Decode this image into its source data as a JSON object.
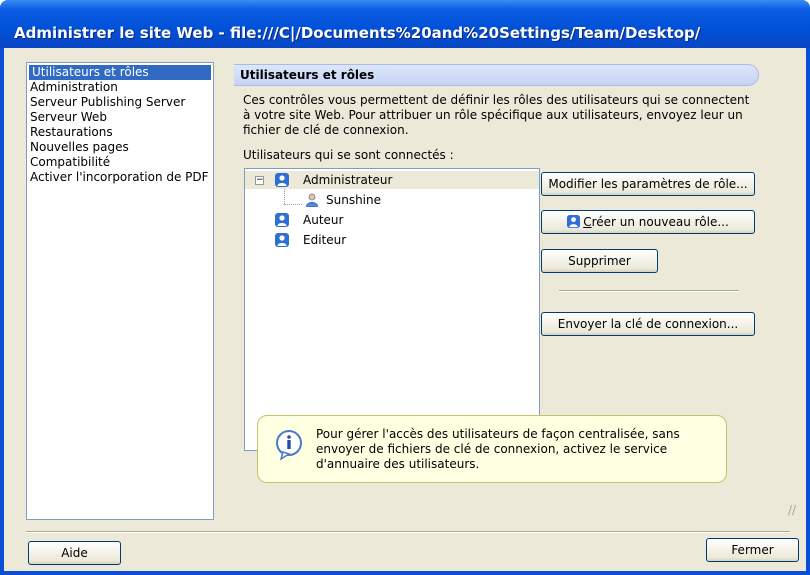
{
  "window": {
    "title": "Administrer le site Web - file:///C|/Documents%20and%20Settings/Team/Desktop/"
  },
  "nav": {
    "items": [
      {
        "label": "Utilisateurs et rôles",
        "selected": true
      },
      {
        "label": "Administration"
      },
      {
        "label": "Serveur Publishing Server"
      },
      {
        "label": "Serveur Web"
      },
      {
        "label": "Restaurations"
      },
      {
        "label": "Nouvelles pages"
      },
      {
        "label": "Compatibilité"
      },
      {
        "label": "Activer l'incorporation de PDF"
      }
    ]
  },
  "section": {
    "title": "Utilisateurs et rôles",
    "description": "Ces contrôles vous permettent de définir les rôles des utilisateurs qui se connectent à votre site Web. Pour attribuer un rôle spécifique aux utilisateurs, envoyez leur un fichier de clé de connexion.",
    "users_label": "Utilisateurs qui se sont connectés :"
  },
  "tree": {
    "expander": "−",
    "roles": [
      {
        "label": "Administrateur",
        "expanded": true,
        "children": [
          {
            "label": "Sunshine"
          }
        ]
      },
      {
        "label": "Auteur"
      },
      {
        "label": "Editeur"
      }
    ]
  },
  "buttons": {
    "modify_role": "Modifier les paramètres de rôle...",
    "create_role_underlined": "C",
    "create_role_rest": "réer un nouveau rôle...",
    "delete": "Supprimer",
    "send_key": "Envoyer la clé de connexion...",
    "help": "Aide",
    "close": "Fermer"
  },
  "info": {
    "icon": "information-icon",
    "text": "Pour gérer l'accès des utilisateurs de façon centralisée, sans envoyer de fichiers de clé de connexion, activez le service d'annuaire des utilisateurs."
  },
  "colors": {
    "title_bar": "#0050d8",
    "selection": "#316ac5",
    "dialog_face": "#ece9d8",
    "info_bg": "#ffffe1",
    "role_icon": "#2f6fd4"
  }
}
